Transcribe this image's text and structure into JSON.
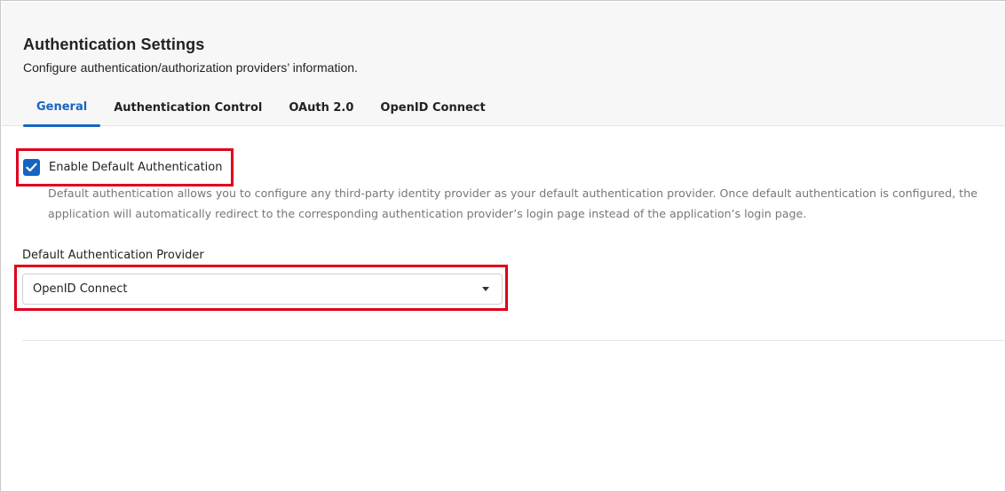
{
  "header": {
    "title": "Authentication Settings",
    "subtitle": "Configure authentication/authorization providers’ information."
  },
  "tabs": [
    {
      "label": "General",
      "active": true
    },
    {
      "label": "Authentication Control",
      "active": false
    },
    {
      "label": "OAuth 2.0",
      "active": false
    },
    {
      "label": "OpenID Connect",
      "active": false
    }
  ],
  "default_auth": {
    "checkbox_label": "Enable Default Authentication",
    "checked": true,
    "help_text": "Default authentication allows you to configure any third-party identity provider as your default authentication provider. Once default authentication is configured, the application will automatically redirect to the corresponding authentication provider’s login page instead of the application’s login page."
  },
  "provider": {
    "label": "Default Authentication Provider",
    "selected": "OpenID Connect"
  },
  "colors": {
    "accent": "#1565c0",
    "highlight": "#e0001a",
    "header_bg": "#f7f7f7"
  },
  "icons": {
    "checkbox": "check-icon",
    "dropdown": "caret-down-icon"
  }
}
